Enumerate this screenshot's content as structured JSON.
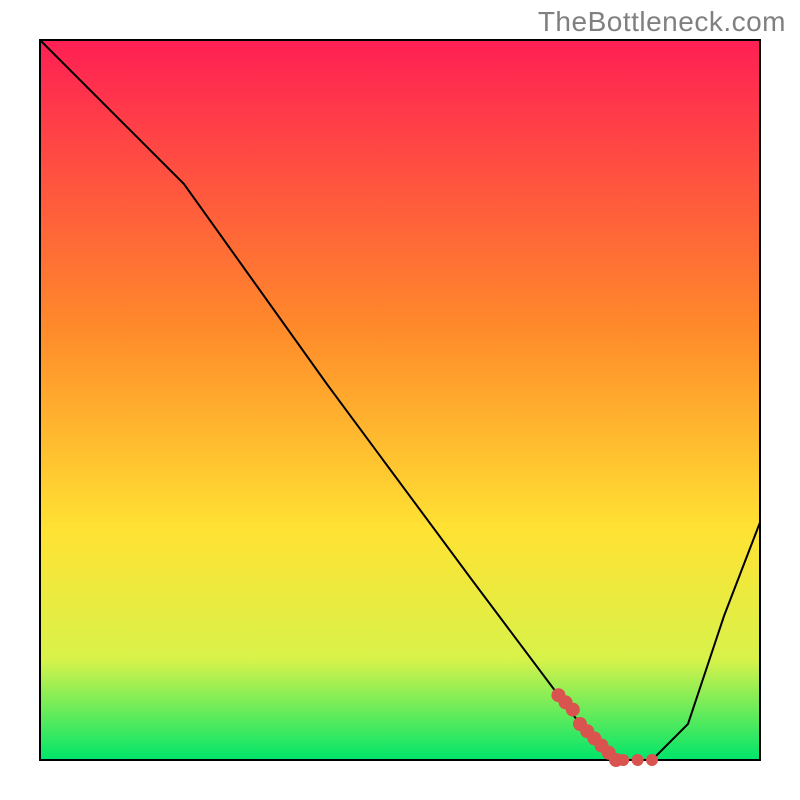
{
  "watermark": "TheBottleneck.com",
  "colors": {
    "gradient_top": "#ff1f54",
    "gradient_mid": "#ffe233",
    "gradient_bottom": "#00e56a",
    "curve": "#000000",
    "marker": "#d9534f"
  },
  "chart_data": {
    "type": "line",
    "title": "",
    "xlabel": "",
    "ylabel": "",
    "xlim": [
      0,
      100
    ],
    "ylim": [
      0,
      100
    ],
    "series": [
      {
        "name": "bottleneck-curve",
        "x": [
          0,
          12,
          20,
          40,
          60,
          75,
          78,
          81,
          85,
          90,
          95,
          100
        ],
        "values": [
          100,
          88,
          80,
          52,
          25,
          5,
          2,
          0,
          0,
          5,
          20,
          33
        ]
      }
    ],
    "markers": {
      "name": "highlight-segment",
      "x": [
        72,
        73,
        74,
        75,
        76,
        77,
        78,
        79,
        80,
        81,
        83,
        85
      ],
      "values": [
        9,
        8,
        7,
        5,
        4,
        3,
        2,
        1,
        0,
        0,
        0,
        0
      ]
    }
  }
}
